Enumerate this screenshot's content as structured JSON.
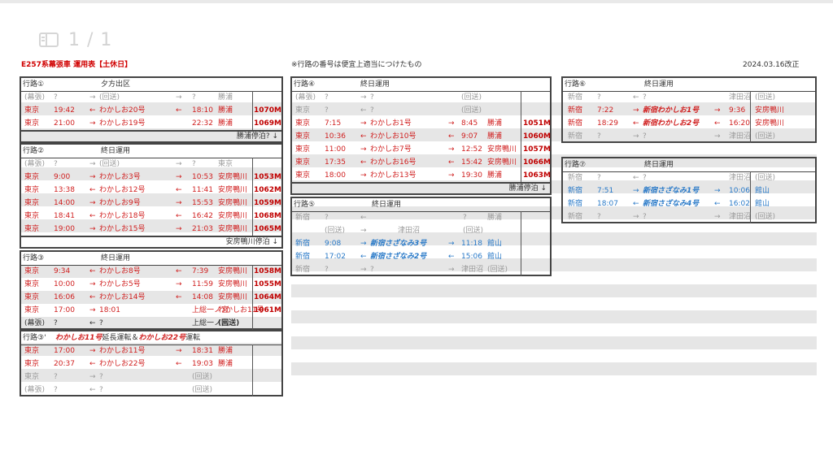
{
  "pager": {
    "text": "1 / 1"
  },
  "header": {
    "title": "E257系幕張車 運用表【土休日】",
    "note": "※行路の番号は便宜上適当につけたもの",
    "date": "2024.03.16改正"
  },
  "blocks": [
    {
      "id": "r1",
      "label": "行路①",
      "title": "夕方出区",
      "rows": [
        {
          "c": "gray",
          "a": "(幕張)",
          "t1": "?",
          "ar": "→",
          "tr": "(回送)",
          "ar2": "→",
          "t2": "?",
          "dst": "勝浦",
          "num": ""
        },
        {
          "c": "red",
          "a": "東京",
          "t1": "19:42",
          "ar": "←",
          "tr": "わかしお20号",
          "ar2": "←",
          "t2": "18:10",
          "dst": "勝浦",
          "num": "1070M"
        },
        {
          "c": "red",
          "a": "東京",
          "t1": "21:00",
          "ar": "→",
          "tr": "わかしお19号",
          "ar2": "",
          "t2": "22:32",
          "dst": "勝浦",
          "num": "1069M"
        }
      ],
      "foot": "勝浦停泊? ↓"
    },
    {
      "id": "r2",
      "label": "行路②",
      "title": "終日運用",
      "rows": [
        {
          "c": "gray",
          "a": "(幕張)",
          "t1": "?",
          "ar": "→",
          "tr": "(回送)",
          "ar2": "→",
          "t2": "?",
          "dst": "東京",
          "num": ""
        },
        {
          "c": "red",
          "a": "東京",
          "t1": "9:00",
          "ar": "→",
          "tr": "わかしお3号",
          "ar2": "→",
          "t2": "10:53",
          "dst": "安房鴨川",
          "num": "1053M"
        },
        {
          "c": "red",
          "a": "東京",
          "t1": "13:38",
          "ar": "←",
          "tr": "わかしお12号",
          "ar2": "←",
          "t2": "11:41",
          "dst": "安房鴨川",
          "num": "1062M"
        },
        {
          "c": "red",
          "a": "東京",
          "t1": "14:00",
          "ar": "→",
          "tr": "わかしお9号",
          "ar2": "→",
          "t2": "15:53",
          "dst": "安房鴨川",
          "num": "1059M"
        },
        {
          "c": "red",
          "a": "東京",
          "t1": "18:41",
          "ar": "←",
          "tr": "わかしお18号",
          "ar2": "←",
          "t2": "16:42",
          "dst": "安房鴨川",
          "num": "1068M"
        },
        {
          "c": "red",
          "a": "東京",
          "t1": "19:00",
          "ar": "→",
          "tr": "わかしお15号",
          "ar2": "→",
          "t2": "21:03",
          "dst": "安房鴨川",
          "num": "1065M"
        }
      ],
      "foot": "安房鴨川停泊 ↓"
    },
    {
      "id": "r3",
      "label": "行路③",
      "title": "終日運用",
      "rows": [
        {
          "c": "red",
          "a": "東京",
          "t1": "9:34",
          "ar": "←",
          "tr": "わかしお8号",
          "ar2": "←",
          "t2": "7:39",
          "dst": "安房鴨川",
          "num": "1058M"
        },
        {
          "c": "red",
          "a": "東京",
          "t1": "10:00",
          "ar": "→",
          "tr": "わかしお5号",
          "ar2": "→",
          "t2": "11:59",
          "dst": "安房鴨川",
          "num": "1055M"
        },
        {
          "c": "red",
          "a": "東京",
          "t1": "16:06",
          "ar": "←",
          "tr": "わかしお14号",
          "ar2": "←",
          "t2": "14:08",
          "dst": "安房鴨川",
          "num": "1064M"
        },
        {
          "c": "red",
          "a": "東京",
          "t1": "17:00",
          "ar": "→",
          "tr": "18:01",
          "ar2": "",
          "t2": "上総一ノ宮",
          "dst": "わかしお11号",
          "num": "1061M"
        },
        {
          "c": "dark",
          "a": "(幕張)",
          "t1": "?",
          "ar": "←",
          "tr": "?",
          "ar2": "",
          "t2": "上総一ノ宮",
          "dst": "(回送)",
          "num": "",
          "dstBold": true
        }
      ]
    },
    {
      "id": "r3b",
      "label": "行路③'",
      "title_parts": [
        {
          "t": "わかしお11号",
          "s": "ri"
        },
        {
          "t": "延長運転＆",
          "s": "d"
        },
        {
          "t": "わかしお22号",
          "s": "ri"
        },
        {
          "t": "運転",
          "s": "d"
        }
      ],
      "rows": [
        {
          "c": "red",
          "a": "東京",
          "t1": "17:00",
          "ar": "→",
          "tr": "わかしお11号",
          "ar2": "→",
          "t2": "18:31",
          "dst": "勝浦",
          "num": ""
        },
        {
          "c": "red",
          "a": "東京",
          "t1": "20:37",
          "ar": "←",
          "tr": "わかしお22号",
          "ar2": "←",
          "t2": "19:03",
          "dst": "勝浦",
          "num": ""
        },
        {
          "c": "gray",
          "a": "東京",
          "t1": "?",
          "ar": "→",
          "tr": "?",
          "ar2": "",
          "t2": "(回送)",
          "dst": "",
          "num": ""
        },
        {
          "c": "gray",
          "a": "(幕張)",
          "t1": "?",
          "ar": "←",
          "tr": "?",
          "ar2": "",
          "t2": "(回送)",
          "dst": "",
          "num": ""
        }
      ]
    },
    {
      "id": "r4",
      "label": "行路④",
      "title": "終日運用",
      "rows": [
        {
          "c": "gray",
          "a": "(幕張)",
          "t1": "?",
          "ar": "→",
          "tr": "?",
          "ar2": "",
          "t2": "(回送)",
          "dst": "",
          "num": ""
        },
        {
          "c": "gray",
          "a": "東京",
          "t1": "?",
          "ar": "←",
          "tr": "?",
          "ar2": "",
          "t2": "(回送)",
          "dst": "",
          "num": ""
        },
        {
          "c": "red",
          "a": "東京",
          "t1": "7:15",
          "ar": "→",
          "tr": "わかしお1号",
          "ar2": "→",
          "t2": "8:45",
          "dst": "勝浦",
          "num": "1051M"
        },
        {
          "c": "red",
          "a": "東京",
          "t1": "10:36",
          "ar": "←",
          "tr": "わかしお10号",
          "ar2": "←",
          "t2": "9:07",
          "dst": "勝浦",
          "num": "1060M"
        },
        {
          "c": "red",
          "a": "東京",
          "t1": "11:00",
          "ar": "→",
          "tr": "わかしお7号",
          "ar2": "→",
          "t2": "12:52",
          "dst": "安房鴨川",
          "num": "1057M"
        },
        {
          "c": "red",
          "a": "東京",
          "t1": "17:35",
          "ar": "←",
          "tr": "わかしお16号",
          "ar2": "←",
          "t2": "15:42",
          "dst": "安房鴨川",
          "num": "1066M"
        },
        {
          "c": "red",
          "a": "東京",
          "t1": "18:00",
          "ar": "→",
          "tr": "わかしお13号",
          "ar2": "→",
          "t2": "19:30",
          "dst": "勝浦",
          "num": "1063M"
        }
      ],
      "foot": "勝浦停泊 ↓"
    },
    {
      "id": "r5",
      "label": "行路⑤",
      "title": "終日運用",
      "rows": [
        {
          "c": "gray",
          "a": "",
          "t1": "(回送)",
          "ar": "→",
          "tr": "津田沼",
          "ar2": "",
          "t2": "(回送)",
          "dst": "",
          "num": "",
          "special": "r5a"
        },
        {
          "c": "blue",
          "a": "新宿",
          "t1": "9:08",
          "ar": "→",
          "tr": "新宿さざなみ3号",
          "ar2": "→",
          "t2": "11:18",
          "dst": "館山",
          "num": "",
          "ti": true
        },
        {
          "c": "blue",
          "a": "新宿",
          "t1": "17:02",
          "ar": "←",
          "tr": "新宿さざなみ2号",
          "ar2": "←",
          "t2": "15:06",
          "dst": "館山",
          "num": "",
          "ti": true
        },
        {
          "c": "gray",
          "a": "新宿",
          "t1": "?",
          "ar": "→",
          "tr": "?",
          "ar2": "→",
          "t2": "津田沼",
          "dst": "(回送)",
          "num": ""
        }
      ]
    },
    {
      "id": "r6",
      "label": "行路⑥",
      "title": "終日運用",
      "rows": [
        {
          "c": "gray",
          "a": "新宿",
          "t1": "?",
          "ar": "←",
          "tr": "?",
          "ar2": "",
          "t2": "津田沼",
          "dst": "(回送)",
          "num": ""
        },
        {
          "c": "red",
          "a": "新宿",
          "t1": "7:22",
          "ar": "→",
          "tr": "新宿わかしお1号",
          "ar2": "→",
          "t2": "9:36",
          "dst": "安房鴨川",
          "num": "",
          "ti": true
        },
        {
          "c": "red",
          "a": "新宿",
          "t1": "18:29",
          "ar": "←",
          "tr": "新宿わかしお2号",
          "ar2": "←",
          "t2": "16:20",
          "dst": "安房鴨川",
          "num": "",
          "ti": true
        },
        {
          "c": "gray",
          "a": "新宿",
          "t1": "?",
          "ar": "→",
          "tr": "?",
          "ar2": "→",
          "t2": "津田沼",
          "dst": "(回送)",
          "num": ""
        }
      ]
    },
    {
      "id": "r7",
      "label": "行路⑦",
      "title": "終日運用",
      "rows": [
        {
          "c": "gray",
          "a": "新宿",
          "t1": "?",
          "ar": "←",
          "tr": "?",
          "ar2": "",
          "t2": "津田沼",
          "dst": "(回送)",
          "num": ""
        },
        {
          "c": "blue",
          "a": "新宿",
          "t1": "7:51",
          "ar": "→",
          "tr": "新宿さざなみ1号",
          "ar2": "→",
          "t2": "10:06",
          "dst": "館山",
          "num": "",
          "ti": true
        },
        {
          "c": "blue",
          "a": "新宿",
          "t1": "18:07",
          "ar": "←",
          "tr": "新宿さざなみ4号",
          "ar2": "←",
          "t2": "16:02",
          "dst": "館山",
          "num": "",
          "ti": true
        },
        {
          "c": "gray",
          "a": "新宿",
          "t1": "?",
          "ar": "→",
          "tr": "?",
          "ar2": "→",
          "t2": "津田沼",
          "dst": "(回送)",
          "num": ""
        }
      ]
    }
  ],
  "r5special": {
    "a": "新宿",
    "t1": "?",
    "ar": "←",
    "t2": "?",
    "dst": "勝浦"
  }
}
